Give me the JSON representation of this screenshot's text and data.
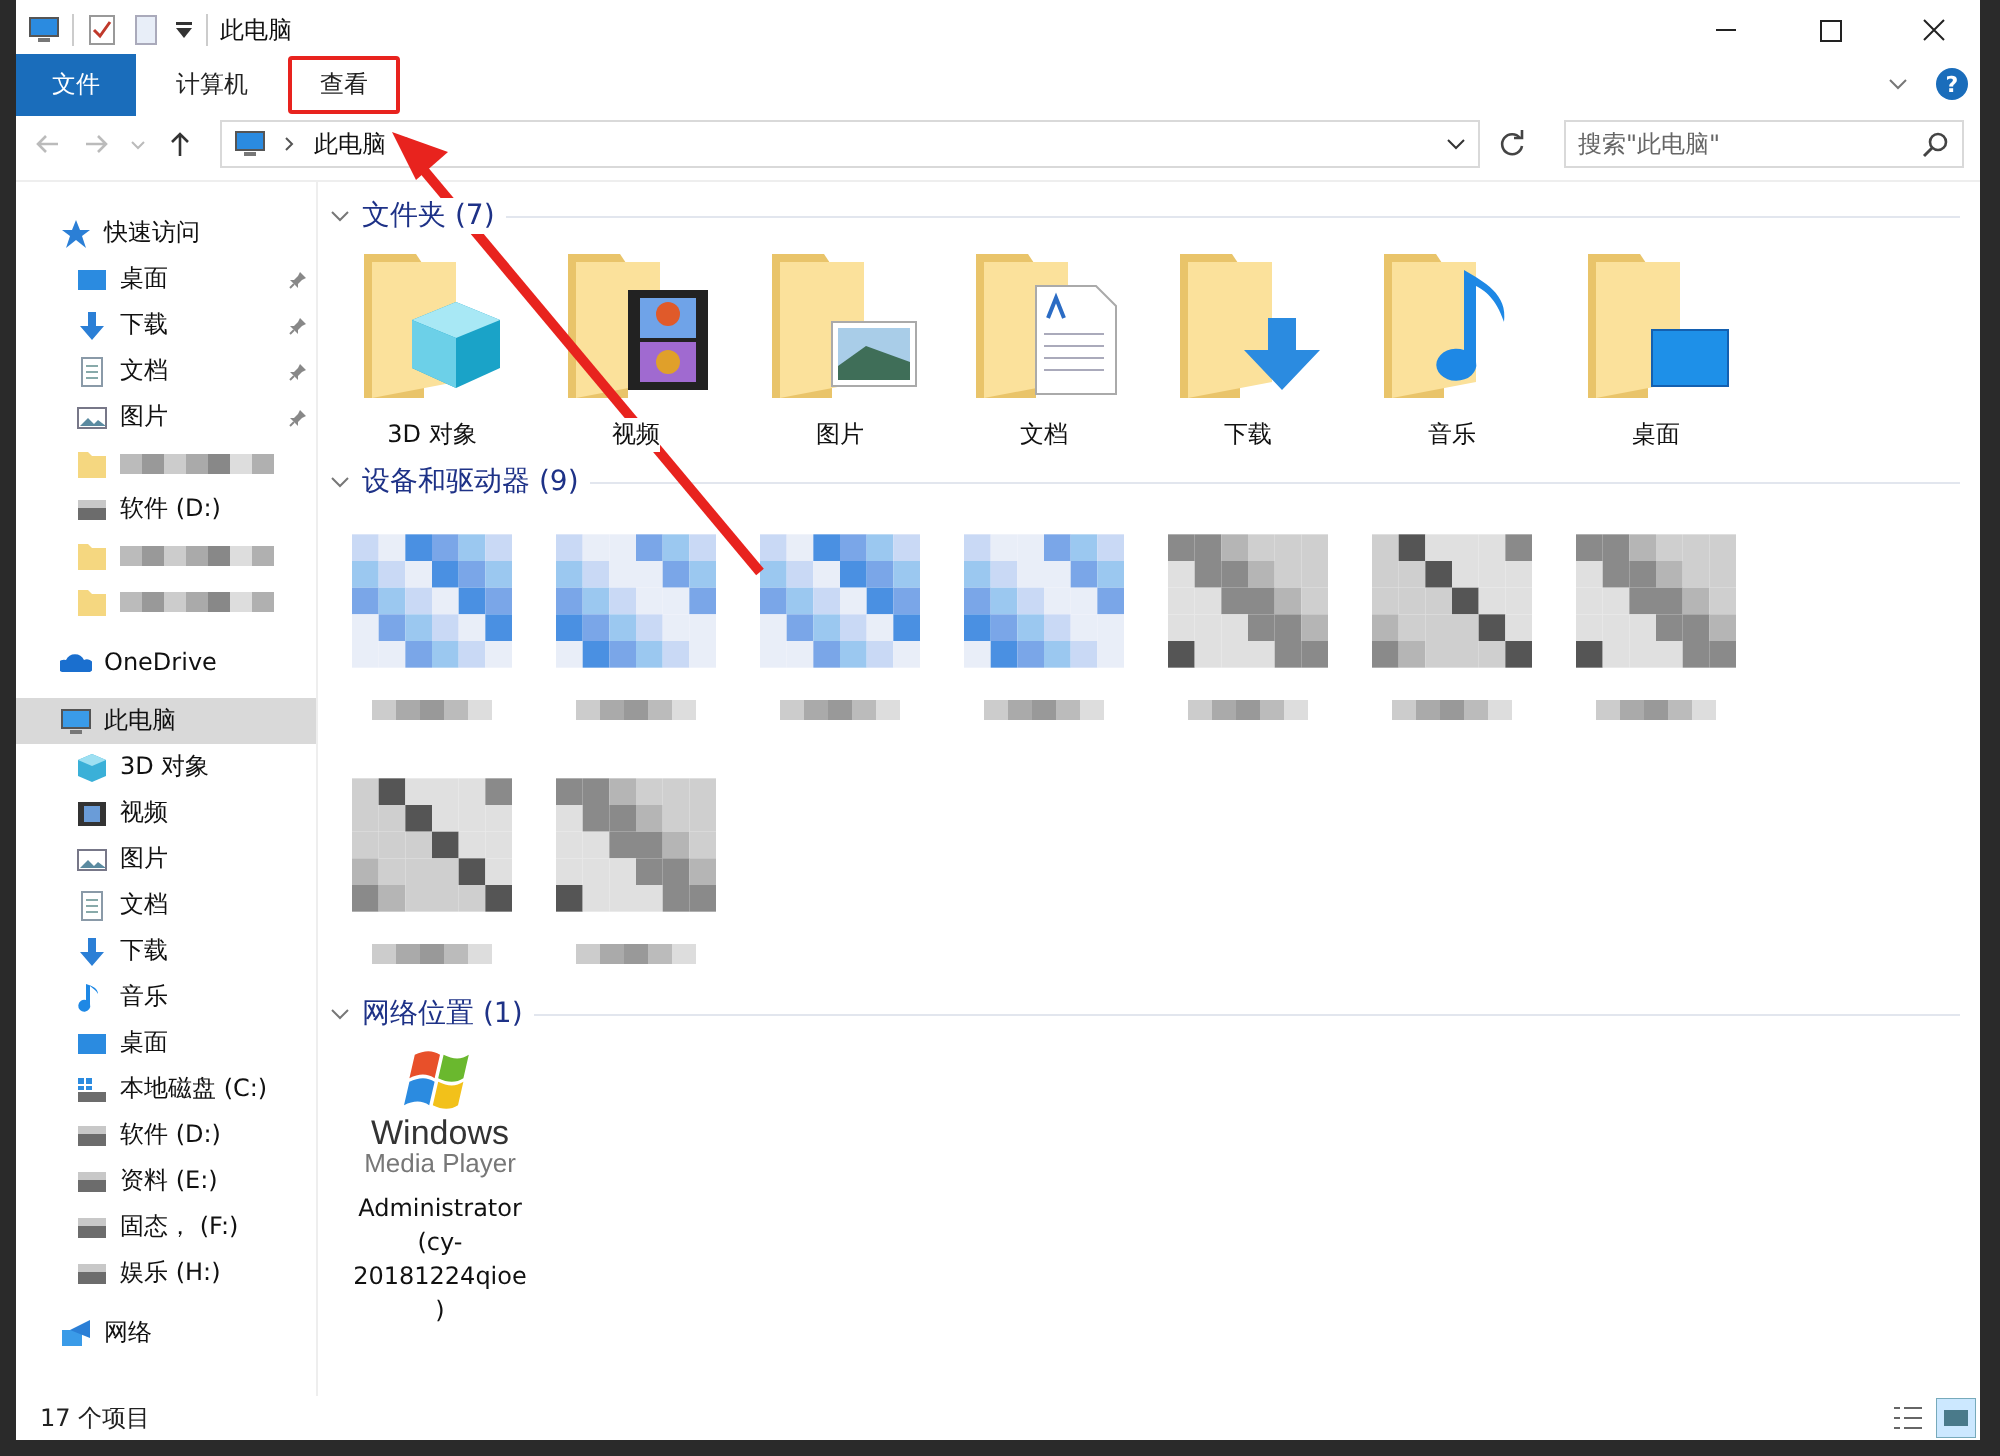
{
  "window": {
    "title": "此电脑"
  },
  "ribbon": {
    "tabs": [
      {
        "label": "文件",
        "kind": "file",
        "selected": false,
        "highlighted": false
      },
      {
        "label": "计算机",
        "kind": "tab",
        "selected": false,
        "highlighted": false
      },
      {
        "label": "查看",
        "kind": "tab",
        "selected": false,
        "highlighted": true
      }
    ],
    "help": "?"
  },
  "address": {
    "path": [
      "此电脑"
    ],
    "search": {
      "placeholder": "搜索\"此电脑\""
    }
  },
  "sidebar": {
    "items": [
      {
        "label": "快速访问",
        "kind": "star",
        "children": [
          {
            "label": "桌面",
            "kind": "desktop",
            "pinned": true
          },
          {
            "label": "下载",
            "kind": "download",
            "pinned": true
          },
          {
            "label": "文档",
            "kind": "document",
            "pinned": true
          },
          {
            "label": "图片",
            "kind": "picture",
            "pinned": true
          },
          {
            "kind": "blurred-folder",
            "pinned": false
          },
          {
            "label": "软件 (D:)",
            "kind": "drive",
            "pinned": false
          },
          {
            "kind": "blurred-folder",
            "pinned": false
          },
          {
            "kind": "blurred-folder",
            "pinned": false
          }
        ]
      },
      {
        "label": "OneDrive",
        "kind": "cloud"
      },
      {
        "label": "此电脑",
        "kind": "pc",
        "selected": true,
        "children": [
          {
            "label": "3D 对象",
            "kind": "cube",
            "pinned": false
          },
          {
            "label": "视频",
            "kind": "video",
            "pinned": false
          },
          {
            "label": "图片",
            "kind": "picture",
            "pinned": false
          },
          {
            "label": "文档",
            "kind": "document",
            "pinned": false
          },
          {
            "label": "下载",
            "kind": "download",
            "pinned": false
          },
          {
            "label": "音乐",
            "kind": "music",
            "pinned": false
          },
          {
            "label": "桌面",
            "kind": "desktop",
            "pinned": false
          },
          {
            "label": "本地磁盘 (C:)",
            "kind": "system-drive",
            "pinned": false
          },
          {
            "label": "软件 (D:)",
            "kind": "drive",
            "pinned": false
          },
          {
            "label": "资料 (E:)",
            "kind": "drive",
            "pinned": false
          },
          {
            "label": "固态， (F:)",
            "kind": "drive",
            "pinned": false
          },
          {
            "label": "娱乐 (H:)",
            "kind": "drive",
            "pinned": false
          }
        ]
      },
      {
        "label": "网络",
        "kind": "network"
      }
    ]
  },
  "sections": [
    {
      "title": "文件夹 (7)",
      "kind": "folders",
      "items": [
        {
          "label": "3D 对象",
          "kind": "cube"
        },
        {
          "label": "视频",
          "kind": "video"
        },
        {
          "label": "图片",
          "kind": "picture"
        },
        {
          "label": "文档",
          "kind": "document"
        },
        {
          "label": "下载",
          "kind": "download"
        },
        {
          "label": "音乐",
          "kind": "music"
        },
        {
          "label": "桌面",
          "kind": "desktop"
        }
      ]
    },
    {
      "title": "设备和驱动器 (9)",
      "kind": "devices",
      "items": [
        {
          "kind": "blurred"
        },
        {
          "kind": "blurred"
        },
        {
          "kind": "blurred"
        },
        {
          "kind": "blurred"
        },
        {
          "kind": "blurred"
        },
        {
          "kind": "blurred"
        },
        {
          "kind": "blurred"
        },
        {
          "kind": "blurred"
        },
        {
          "kind": "blurred"
        }
      ]
    },
    {
      "title": "网络位置 (1)",
      "kind": "network",
      "items": [
        {
          "label": "Administrator (cy-20181224qioe)",
          "kind": "media-player",
          "logo_text": [
            "Windows",
            "Media Player"
          ]
        }
      ]
    }
  ],
  "status_bar": {
    "count": "17 个项目"
  }
}
